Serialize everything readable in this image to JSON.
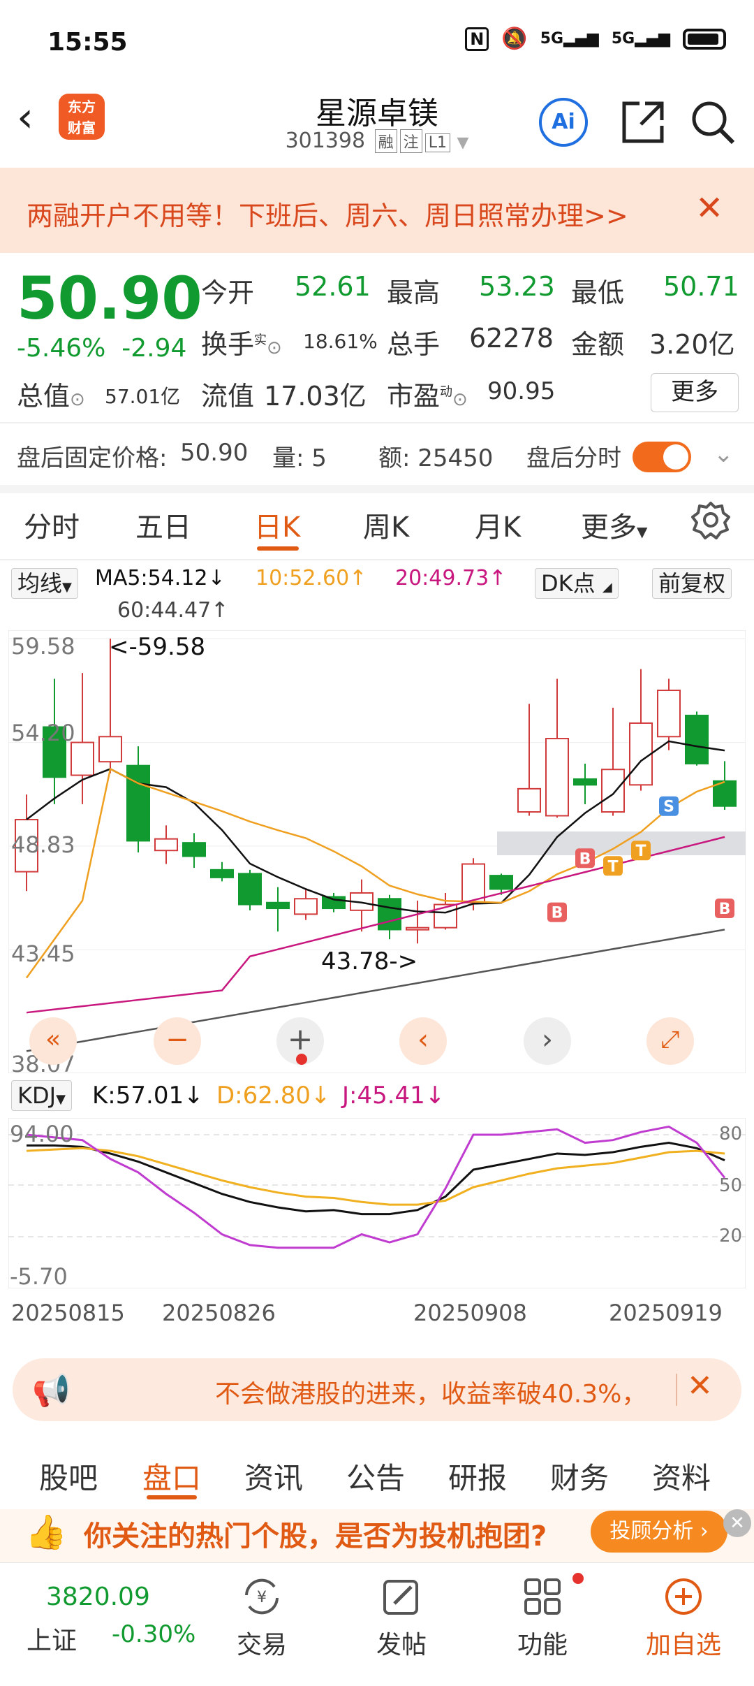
{
  "status_bar": {
    "time": "15:55",
    "net1": "5G",
    "net2": "5G"
  },
  "header": {
    "logo_text": "东方财富",
    "title": "星源卓镁",
    "code": "301398",
    "tags": [
      "融",
      "注",
      "L1"
    ],
    "ai_label": "Ai"
  },
  "banner": {
    "text": "两融开户不用等！下班后、周六、周日照常办理>>"
  },
  "quote": {
    "price": "50.90",
    "change_pct": "-5.46%",
    "change": "-2.94",
    "open_label": "今开",
    "open": "52.61",
    "high_label": "最高",
    "high": "53.23",
    "low_label": "最低",
    "low": "50.71",
    "turnover_label": "换手",
    "turnover_sup": "实",
    "turnover": "18.61%",
    "volume_label": "总手",
    "volume": "62278",
    "amount_label": "金额",
    "amount": "3.20亿",
    "mktcap_label": "总值",
    "mktcap": "57.01亿",
    "float_label": "流值",
    "float": "17.03亿",
    "pe_label": "市盈",
    "pe_sup": "动",
    "pe": "90.95",
    "more": "更多"
  },
  "after_hours": {
    "price_label": "盘后固定价格:",
    "price": "50.90",
    "vol_label": "量:",
    "vol": "5",
    "amt_label": "额:",
    "amt": "25450",
    "toggle_label": "盘后分时"
  },
  "chart_tabs": [
    "分时",
    "五日",
    "日K",
    "周K",
    "月K",
    "更多"
  ],
  "active_chart_tab": "日K",
  "ma": {
    "selector": "均线",
    "ma5": "MA5:54.12↓",
    "ma10": "10:52.60↑",
    "ma20": "20:49.73↑",
    "ma60": "60:44.47↑",
    "dk": "DK点",
    "adjust": "前复权"
  },
  "price_axis": [
    "59.58",
    "54.20",
    "48.83",
    "43.45",
    "38.07"
  ],
  "annotations": {
    "high": "<-59.58",
    "low": "43.78->"
  },
  "markers": [
    "B",
    "B",
    "T",
    "T",
    "S",
    "B"
  ],
  "kdj": {
    "selector": "KDJ",
    "k": "K:57.01↓",
    "d": "D:62.80↓",
    "j": "J:45.41↓",
    "axis_left": [
      "94.00",
      "-5.70"
    ],
    "axis_right": [
      "80",
      "50",
      "20"
    ]
  },
  "dates": [
    "20250815",
    "20250826",
    "20250908",
    "20250919"
  ],
  "colors": {
    "up": "#d23b3b",
    "down": "#109a2f",
    "accent": "#e05a14",
    "ma5": "#111111",
    "ma10": "#f0a020",
    "ma20": "#c8177e",
    "ma60": "#555555"
  },
  "chart_data": {
    "type": "candlestick",
    "ylim": [
      38.07,
      59.58
    ],
    "candles": [
      {
        "o": 47.5,
        "c": 50.2,
        "h": 51.5,
        "l": 46.5
      },
      {
        "o": 55.0,
        "c": 52.4,
        "h": 57.5,
        "l": 51.0
      },
      {
        "o": 52.5,
        "c": 54.2,
        "h": 57.8,
        "l": 51.0
      },
      {
        "o": 53.2,
        "c": 54.5,
        "h": 59.58,
        "l": 52.6
      },
      {
        "o": 53.0,
        "c": 49.1,
        "h": 54.0,
        "l": 48.5
      },
      {
        "o": 48.6,
        "c": 49.2,
        "h": 49.9,
        "l": 47.9
      },
      {
        "o": 49.0,
        "c": 48.3,
        "h": 49.5,
        "l": 47.7
      },
      {
        "o": 47.6,
        "c": 47.2,
        "h": 48.0,
        "l": 47.0
      },
      {
        "o": 47.4,
        "c": 45.8,
        "h": 47.6,
        "l": 45.5
      },
      {
        "o": 45.9,
        "c": 45.6,
        "h": 46.7,
        "l": 44.4
      },
      {
        "o": 45.3,
        "c": 46.1,
        "h": 46.6,
        "l": 45.0
      },
      {
        "o": 46.2,
        "c": 45.6,
        "h": 46.4,
        "l": 45.4
      },
      {
        "o": 45.5,
        "c": 46.4,
        "h": 47.1,
        "l": 44.4
      },
      {
        "o": 46.1,
        "c": 44.5,
        "h": 46.3,
        "l": 44.0
      },
      {
        "o": 44.6,
        "c": 44.6,
        "h": 46.0,
        "l": 43.78
      },
      {
        "o": 44.6,
        "c": 45.8,
        "h": 46.4,
        "l": 44.5
      },
      {
        "o": 45.9,
        "c": 47.9,
        "h": 48.2,
        "l": 45.5
      },
      {
        "o": 47.3,
        "c": 46.6,
        "h": 47.4,
        "l": 46.3
      },
      {
        "o": 50.6,
        "c": 51.8,
        "h": 56.2,
        "l": 50.4
      },
      {
        "o": 50.4,
        "c": 54.4,
        "h": 57.5,
        "l": 50.3
      },
      {
        "o": 52.3,
        "c": 52.0,
        "h": 53.1,
        "l": 51.0
      },
      {
        "o": 50.6,
        "c": 52.8,
        "h": 56.0,
        "l": 50.4
      },
      {
        "o": 52.0,
        "c": 55.2,
        "h": 58.0,
        "l": 51.7
      },
      {
        "o": 54.5,
        "c": 56.9,
        "h": 57.5,
        "l": 53.8
      },
      {
        "o": 55.6,
        "c": 53.1,
        "h": 55.8,
        "l": 53.0
      },
      {
        "o": 52.2,
        "c": 50.9,
        "h": 53.23,
        "l": 50.71
      }
    ]
  }
}
